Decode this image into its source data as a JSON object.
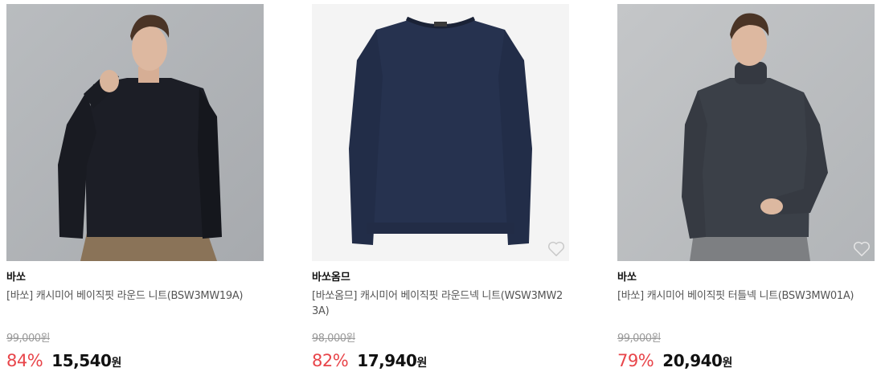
{
  "products": [
    {
      "image": "model-black-crewneck-sweater",
      "brand": "바쏘",
      "name": "[바쏘] 캐시미어 베이직핏 라운드 니트(BSW3MW19A)",
      "original_price": "99,000원",
      "discount_rate": "84%",
      "sale_price": "15,540",
      "currency": "원",
      "wishlist_icon": "heart-outline-icon",
      "wishlist_visible": false
    },
    {
      "image": "navy-crewneck-sweater-flatlay",
      "brand": "바쏘옴므",
      "name": "[바쏘옴므] 캐시미어 베이직핏 라운드넥 니트(WSW3MW23A)",
      "original_price": "98,000원",
      "discount_rate": "82%",
      "sale_price": "17,940",
      "currency": "원",
      "wishlist_icon": "heart-outline-icon",
      "wishlist_visible": true
    },
    {
      "image": "model-charcoal-turtleneck-sweater",
      "brand": "바쏘",
      "name": "[바쏘] 캐시미어 베이직핏 터틀넥 니트(BSW3MW01A)",
      "original_price": "99,000원",
      "discount_rate": "79%",
      "sale_price": "20,940",
      "currency": "원",
      "wishlist_icon": "heart-outline-icon",
      "wishlist_visible": true
    }
  ],
  "colors": {
    "discount": "#e8454a",
    "price": "#111111",
    "original_price": "#999999"
  }
}
